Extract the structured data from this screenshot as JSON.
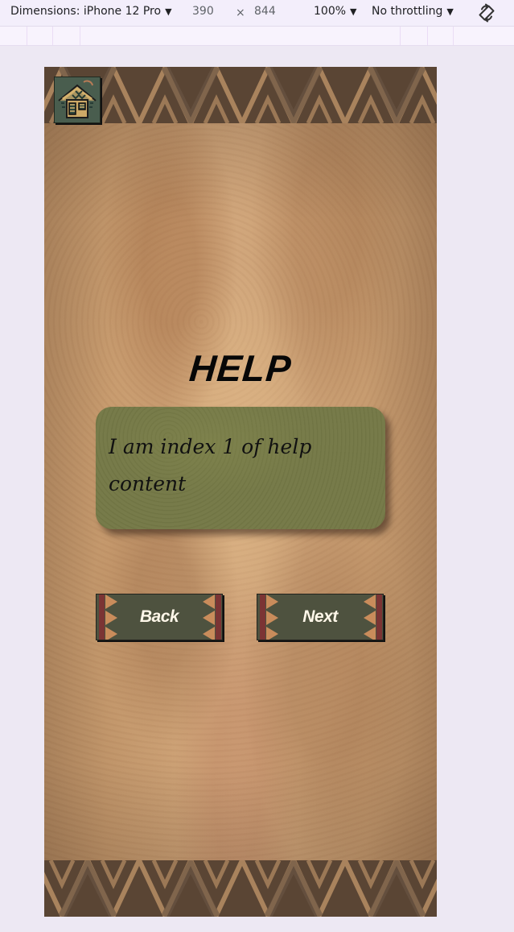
{
  "devtools": {
    "dimensions_label": "Dimensions: iPhone 12 Pro",
    "width": "390",
    "times": "×",
    "height": "844",
    "zoom": "100%",
    "throttling": "No throttling",
    "rotate_icon": "rotate-icon",
    "caret": "▼"
  },
  "app": {
    "home_icon": "home-icon",
    "title": "HELP",
    "help_text": "I am index 1 of help content",
    "back_label": "Back",
    "next_label": "Next",
    "colors": {
      "page_background": "#ede8f3",
      "devtools_background": "#f3eefb",
      "parchment": "#c99f73",
      "band_dark": "#5a4534",
      "card_green": "#747846",
      "button_green": "#4e523f",
      "triangle_tan": "#c98c5b",
      "stripe_red": "#7b3434"
    }
  }
}
